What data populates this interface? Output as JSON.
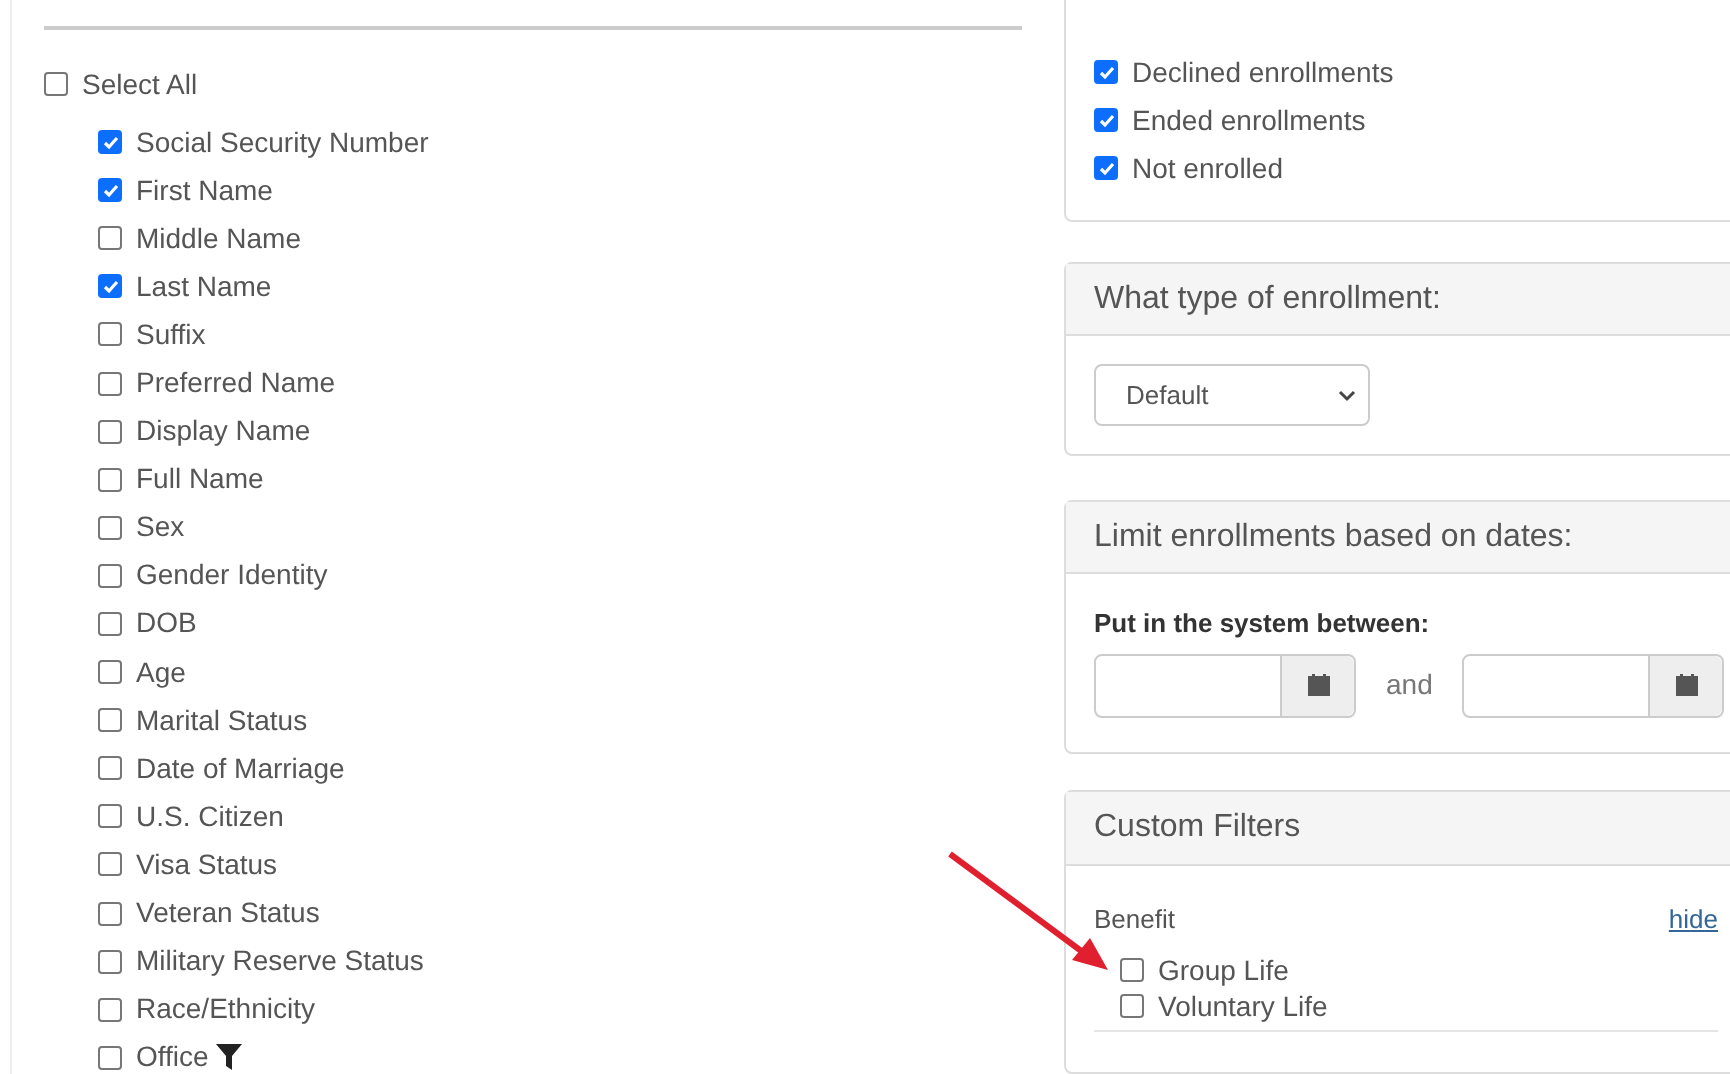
{
  "fields": {
    "select_all": {
      "label": "Select All",
      "checked": false
    },
    "items": [
      {
        "label": "Social Security Number",
        "checked": true
      },
      {
        "label": "First Name",
        "checked": true
      },
      {
        "label": "Middle Name",
        "checked": false
      },
      {
        "label": "Last Name",
        "checked": true
      },
      {
        "label": "Suffix",
        "checked": false
      },
      {
        "label": "Preferred Name",
        "checked": false
      },
      {
        "label": "Display Name",
        "checked": false
      },
      {
        "label": "Full Name",
        "checked": false
      },
      {
        "label": "Sex",
        "checked": false
      },
      {
        "label": "Gender Identity",
        "checked": false
      },
      {
        "label": "DOB",
        "checked": false
      },
      {
        "label": "Age",
        "checked": false
      },
      {
        "label": "Marital Status",
        "checked": false
      },
      {
        "label": "Date of Marriage",
        "checked": false
      },
      {
        "label": "U.S. Citizen",
        "checked": false
      },
      {
        "label": "Visa Status",
        "checked": false
      },
      {
        "label": "Veteran Status",
        "checked": false
      },
      {
        "label": "Military Reserve Status",
        "checked": false
      },
      {
        "label": "Race/Ethnicity",
        "checked": false
      },
      {
        "label": "Office",
        "checked": false,
        "filter": true
      }
    ]
  },
  "enrollment_status": [
    {
      "label": "Declined enrollments",
      "checked": true
    },
    {
      "label": "Ended enrollments",
      "checked": true
    },
    {
      "label": "Not enrolled",
      "checked": true
    }
  ],
  "enrollment_type": {
    "title": "What type of enrollment:",
    "value": "Default"
  },
  "date_limit": {
    "title": "Limit enrollments based on dates:",
    "label": "Put in the system between:",
    "separator": "and"
  },
  "custom_filters": {
    "title": "Custom Filters",
    "group": "Benefit",
    "toggle": "hide",
    "options": [
      {
        "label": "Group Life",
        "checked": false
      },
      {
        "label": "Voluntary Life",
        "checked": false
      }
    ]
  }
}
